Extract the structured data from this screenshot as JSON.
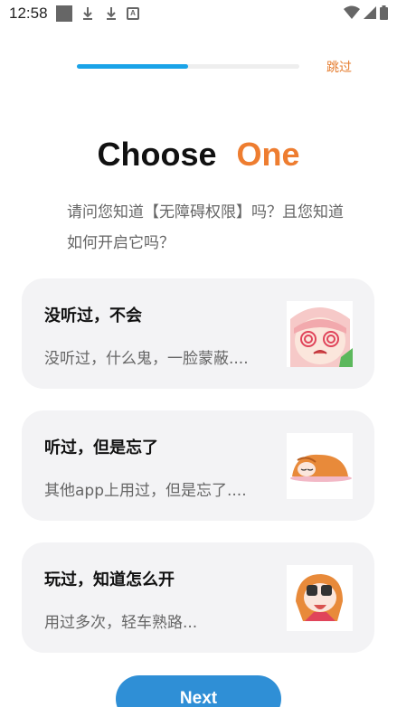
{
  "status_bar": {
    "time": "12:58",
    "icons_left": [
      "square-notification-icon",
      "download-icon",
      "download-icon",
      "app-a-icon"
    ],
    "a_label": "A",
    "icons_right": [
      "wifi-icon",
      "signal-icon",
      "battery-icon"
    ]
  },
  "progress": {
    "value": 0.5,
    "color": "#1aa3e8"
  },
  "skip_label": "跳过",
  "title": {
    "part1": "Choose",
    "part2": "One"
  },
  "question": "请问您知道【无障碍权限】吗？且您知道如何开启它吗？",
  "options": [
    {
      "title": "没听过，不会",
      "subtitle": "没听过，什么鬼，一脸蒙蔽....",
      "image": "anime-girl-confused-icon"
    },
    {
      "title": "听过，但是忘了",
      "subtitle": "其他app上用过，但是忘了....",
      "image": "anime-girl-sleeping-icon"
    },
    {
      "title": "玩过，知道怎么开",
      "subtitle": "用过多次，轻车熟路...",
      "image": "anime-girl-binoculars-icon"
    }
  ],
  "next_label": "Next",
  "colors": {
    "accent": "#ee7d30",
    "primary": "#2f8fd6",
    "card_bg": "#f3f3f5"
  }
}
